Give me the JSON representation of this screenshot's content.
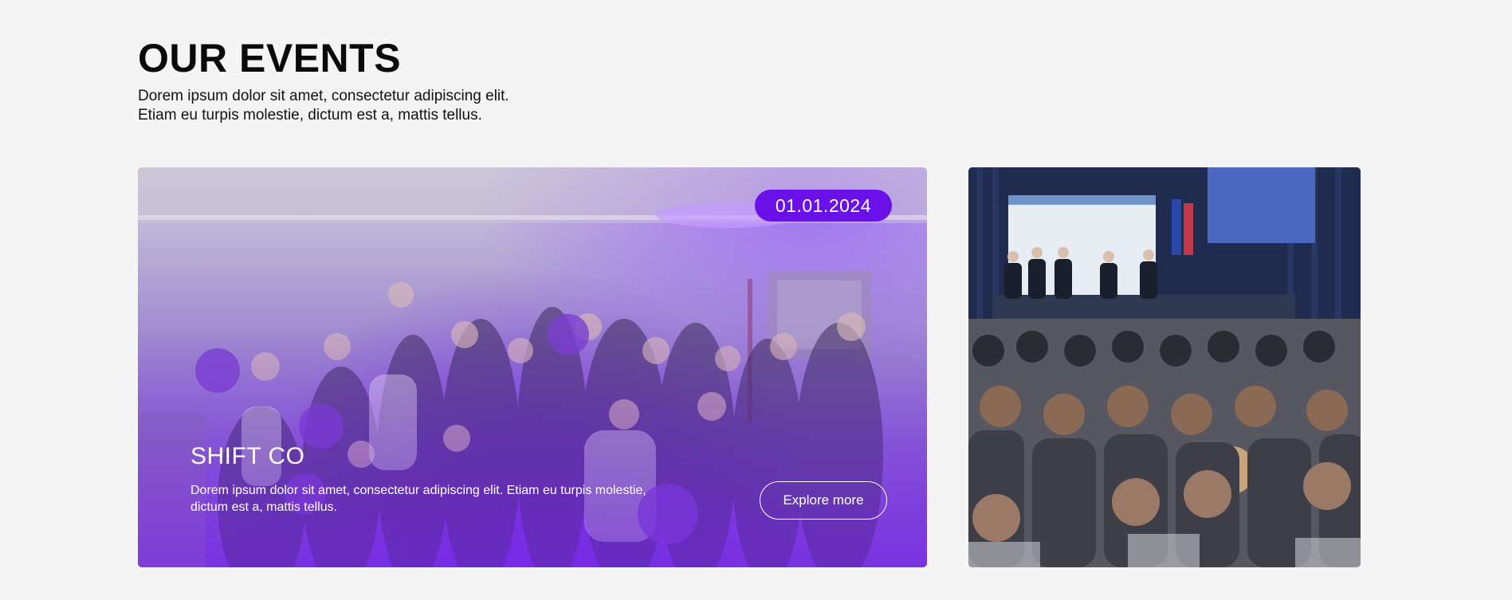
{
  "header": {
    "title": "OUR EVENTS",
    "subtitle_line1": "Dorem ipsum dolor sit amet, consectetur adipiscing elit.",
    "subtitle_line2": "Etiam eu turpis molestie, dictum est a, mattis tellus."
  },
  "featured_event": {
    "date": "01.01.2024",
    "name": "SHIFT CO",
    "description": "Dorem ipsum dolor sit amet, consectetur adipiscing elit. Etiam eu turpis molestie, dictum est a, mattis tellus.",
    "cta_label": "Explore more",
    "image": "group-photo-shift-co"
  },
  "secondary_event": {
    "image": "conference-audience-panel-photo"
  },
  "colors": {
    "background": "#f4f4f4",
    "accent_purple": "#6a10e8",
    "text_dark": "#0a0a0a",
    "text_light": "#ffffff"
  }
}
